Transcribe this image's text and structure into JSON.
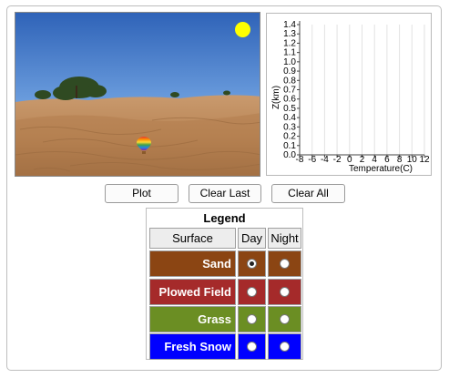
{
  "buttons": {
    "plot": "Plot",
    "clear_last": "Clear Last",
    "clear_all": "Clear All"
  },
  "graph": {
    "y_axis_label": "Z(km)",
    "x_axis_label": "Temperature(C)",
    "y_ticks": [
      "0.0",
      "0.1",
      "0.2",
      "0.3",
      "0.4",
      "0.5",
      "0.6",
      "0.7",
      "0.8",
      "0.9",
      "1.0",
      "1.1",
      "1.2",
      "1.3",
      "1.4"
    ],
    "x_ticks": [
      "-8",
      "-6",
      "-4",
      "-2",
      "0",
      "2",
      "4",
      "6",
      "8",
      "10",
      "12"
    ]
  },
  "legend": {
    "title": "Legend",
    "header_surface": "Surface",
    "header_day": "Day",
    "header_night": "Night",
    "rows": [
      {
        "label": "Sand",
        "color": "#8b4513",
        "day_checked": true,
        "night_checked": false
      },
      {
        "label": "Plowed Field",
        "color": "#a52a2a",
        "day_checked": false,
        "night_checked": false
      },
      {
        "label": "Grass",
        "color": "#6b8e23",
        "day_checked": false,
        "night_checked": false
      },
      {
        "label": "Fresh Snow",
        "color": "#0000ff",
        "day_checked": false,
        "night_checked": false
      }
    ]
  },
  "scene": {
    "sun_color": "#ffff00",
    "balloon_icon": "hot-air-balloon-icon"
  },
  "colors": {
    "sand": "#8b4513",
    "plowed_field": "#a52a2a",
    "grass": "#6b8e23",
    "fresh_snow": "#0000ff"
  }
}
